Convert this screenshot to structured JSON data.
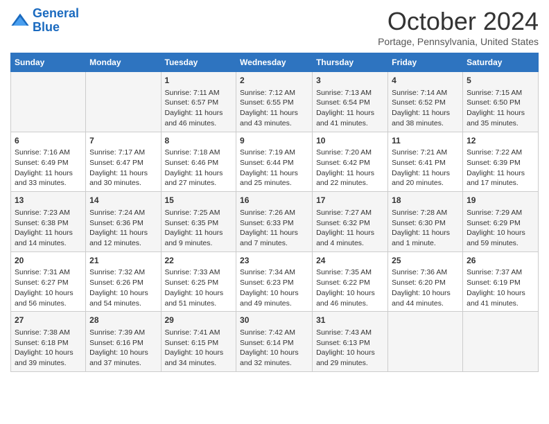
{
  "logo": {
    "line1": "General",
    "line2": "Blue"
  },
  "title": "October 2024",
  "subtitle": "Portage, Pennsylvania, United States",
  "days_of_week": [
    "Sunday",
    "Monday",
    "Tuesday",
    "Wednesday",
    "Thursday",
    "Friday",
    "Saturday"
  ],
  "weeks": [
    [
      {
        "day": "",
        "content": ""
      },
      {
        "day": "",
        "content": ""
      },
      {
        "day": "1",
        "content": "Sunrise: 7:11 AM\nSunset: 6:57 PM\nDaylight: 11 hours and 46 minutes."
      },
      {
        "day": "2",
        "content": "Sunrise: 7:12 AM\nSunset: 6:55 PM\nDaylight: 11 hours and 43 minutes."
      },
      {
        "day": "3",
        "content": "Sunrise: 7:13 AM\nSunset: 6:54 PM\nDaylight: 11 hours and 41 minutes."
      },
      {
        "day": "4",
        "content": "Sunrise: 7:14 AM\nSunset: 6:52 PM\nDaylight: 11 hours and 38 minutes."
      },
      {
        "day": "5",
        "content": "Sunrise: 7:15 AM\nSunset: 6:50 PM\nDaylight: 11 hours and 35 minutes."
      }
    ],
    [
      {
        "day": "6",
        "content": "Sunrise: 7:16 AM\nSunset: 6:49 PM\nDaylight: 11 hours and 33 minutes."
      },
      {
        "day": "7",
        "content": "Sunrise: 7:17 AM\nSunset: 6:47 PM\nDaylight: 11 hours and 30 minutes."
      },
      {
        "day": "8",
        "content": "Sunrise: 7:18 AM\nSunset: 6:46 PM\nDaylight: 11 hours and 27 minutes."
      },
      {
        "day": "9",
        "content": "Sunrise: 7:19 AM\nSunset: 6:44 PM\nDaylight: 11 hours and 25 minutes."
      },
      {
        "day": "10",
        "content": "Sunrise: 7:20 AM\nSunset: 6:42 PM\nDaylight: 11 hours and 22 minutes."
      },
      {
        "day": "11",
        "content": "Sunrise: 7:21 AM\nSunset: 6:41 PM\nDaylight: 11 hours and 20 minutes."
      },
      {
        "day": "12",
        "content": "Sunrise: 7:22 AM\nSunset: 6:39 PM\nDaylight: 11 hours and 17 minutes."
      }
    ],
    [
      {
        "day": "13",
        "content": "Sunrise: 7:23 AM\nSunset: 6:38 PM\nDaylight: 11 hours and 14 minutes."
      },
      {
        "day": "14",
        "content": "Sunrise: 7:24 AM\nSunset: 6:36 PM\nDaylight: 11 hours and 12 minutes."
      },
      {
        "day": "15",
        "content": "Sunrise: 7:25 AM\nSunset: 6:35 PM\nDaylight: 11 hours and 9 minutes."
      },
      {
        "day": "16",
        "content": "Sunrise: 7:26 AM\nSunset: 6:33 PM\nDaylight: 11 hours and 7 minutes."
      },
      {
        "day": "17",
        "content": "Sunrise: 7:27 AM\nSunset: 6:32 PM\nDaylight: 11 hours and 4 minutes."
      },
      {
        "day": "18",
        "content": "Sunrise: 7:28 AM\nSunset: 6:30 PM\nDaylight: 11 hours and 1 minute."
      },
      {
        "day": "19",
        "content": "Sunrise: 7:29 AM\nSunset: 6:29 PM\nDaylight: 10 hours and 59 minutes."
      }
    ],
    [
      {
        "day": "20",
        "content": "Sunrise: 7:31 AM\nSunset: 6:27 PM\nDaylight: 10 hours and 56 minutes."
      },
      {
        "day": "21",
        "content": "Sunrise: 7:32 AM\nSunset: 6:26 PM\nDaylight: 10 hours and 54 minutes."
      },
      {
        "day": "22",
        "content": "Sunrise: 7:33 AM\nSunset: 6:25 PM\nDaylight: 10 hours and 51 minutes."
      },
      {
        "day": "23",
        "content": "Sunrise: 7:34 AM\nSunset: 6:23 PM\nDaylight: 10 hours and 49 minutes."
      },
      {
        "day": "24",
        "content": "Sunrise: 7:35 AM\nSunset: 6:22 PM\nDaylight: 10 hours and 46 minutes."
      },
      {
        "day": "25",
        "content": "Sunrise: 7:36 AM\nSunset: 6:20 PM\nDaylight: 10 hours and 44 minutes."
      },
      {
        "day": "26",
        "content": "Sunrise: 7:37 AM\nSunset: 6:19 PM\nDaylight: 10 hours and 41 minutes."
      }
    ],
    [
      {
        "day": "27",
        "content": "Sunrise: 7:38 AM\nSunset: 6:18 PM\nDaylight: 10 hours and 39 minutes."
      },
      {
        "day": "28",
        "content": "Sunrise: 7:39 AM\nSunset: 6:16 PM\nDaylight: 10 hours and 37 minutes."
      },
      {
        "day": "29",
        "content": "Sunrise: 7:41 AM\nSunset: 6:15 PM\nDaylight: 10 hours and 34 minutes."
      },
      {
        "day": "30",
        "content": "Sunrise: 7:42 AM\nSunset: 6:14 PM\nDaylight: 10 hours and 32 minutes."
      },
      {
        "day": "31",
        "content": "Sunrise: 7:43 AM\nSunset: 6:13 PM\nDaylight: 10 hours and 29 minutes."
      },
      {
        "day": "",
        "content": ""
      },
      {
        "day": "",
        "content": ""
      }
    ]
  ]
}
